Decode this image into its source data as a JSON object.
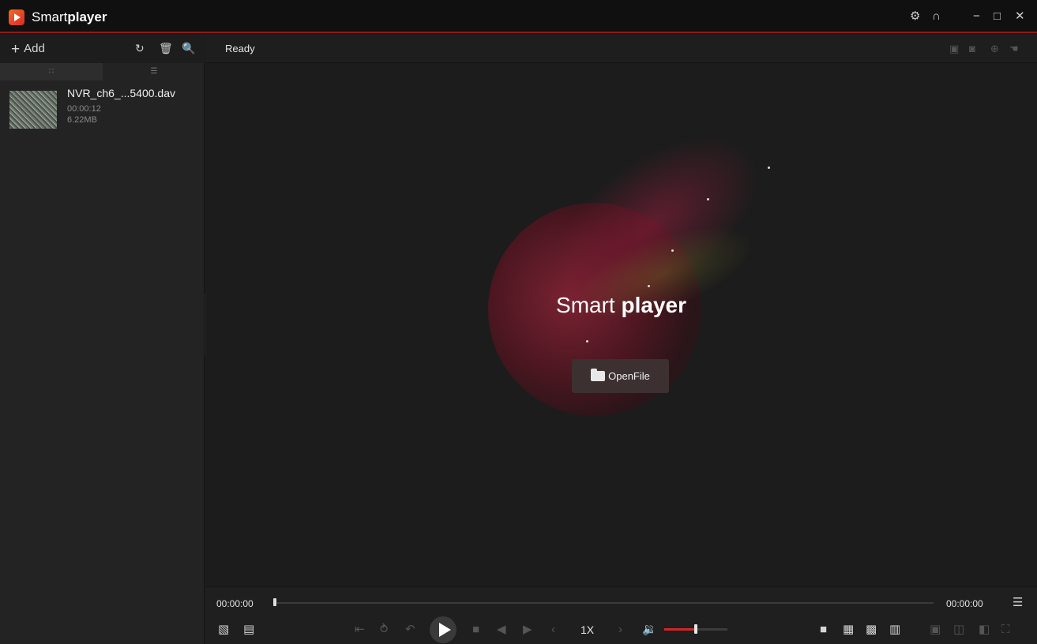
{
  "app": {
    "title_light": "Smart",
    "title_bold": "player"
  },
  "titlebar_icons": [
    "gear-icon",
    "headset-icon",
    "minimize-icon",
    "maximize-icon",
    "close-icon"
  ],
  "sidebar": {
    "add_label": "Add",
    "tabs": [
      "grid-view",
      "list-view"
    ],
    "files": [
      {
        "name": "NVR_ch6_...5400.dav",
        "duration": "00:00:12",
        "size": "6.22MB"
      }
    ]
  },
  "main": {
    "status": "Ready",
    "brand_light": "Smart",
    "brand_bold": "player",
    "open_file_label": "OpenFile"
  },
  "playback": {
    "current_time": "00:00:00",
    "total_time": "00:00:00",
    "progress": 0,
    "speed": "1X",
    "volume": 0.5
  },
  "colors": {
    "accent": "#d02727",
    "titlebar_border": "#8e1b1b"
  }
}
